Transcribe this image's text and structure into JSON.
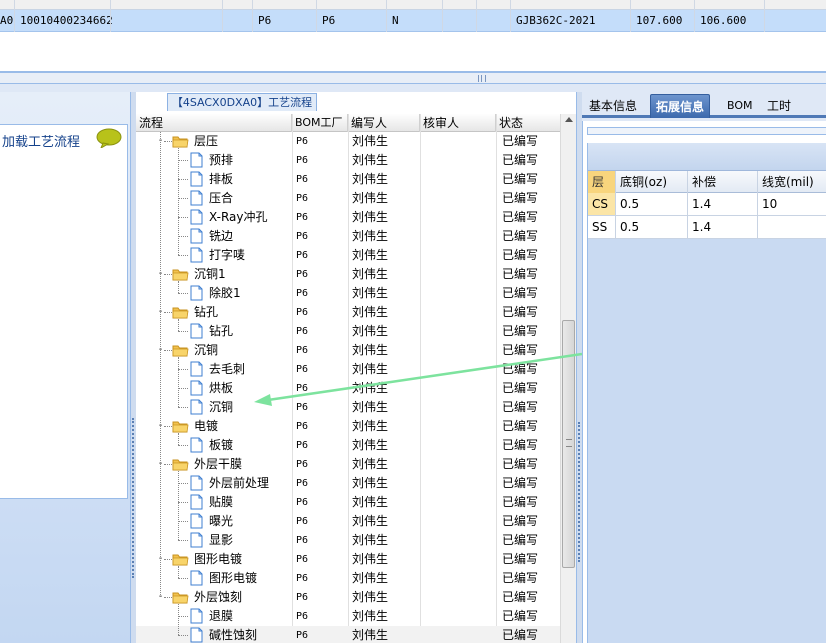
{
  "top_grid": {
    "row": {
      "c0": "A0",
      "c1": "10010400234662",
      "c2": "P6",
      "c3": "P6",
      "c4": "N",
      "c5": "GJB362C-2021",
      "c6": "107.600",
      "c7": "106.600"
    }
  },
  "left_panel": {
    "title": "加载工艺流程",
    "icon": "speech-bubble-icon"
  },
  "tree": {
    "tab_label": "【4SACX0DXA0】工艺流程",
    "headers": {
      "process": "流程",
      "bom": "BOM工厂",
      "writer": "编写人",
      "reviewer": "核审人",
      "status": "状态"
    },
    "nodes": [
      {
        "label": "层压",
        "type": "folder",
        "bom": "P6",
        "writer": "刘伟生",
        "reviewer": "",
        "status": "已编写"
      },
      {
        "label": "预排",
        "type": "file",
        "bom": "P6",
        "writer": "刘伟生",
        "reviewer": "",
        "status": "已编写"
      },
      {
        "label": "排板",
        "type": "file",
        "bom": "P6",
        "writer": "刘伟生",
        "reviewer": "",
        "status": "已编写"
      },
      {
        "label": "压合",
        "type": "file",
        "bom": "P6",
        "writer": "刘伟生",
        "reviewer": "",
        "status": "已编写"
      },
      {
        "label": "X-Ray冲孔",
        "type": "file",
        "bom": "P6",
        "writer": "刘伟生",
        "reviewer": "",
        "status": "已编写"
      },
      {
        "label": "铣边",
        "type": "file",
        "bom": "P6",
        "writer": "刘伟生",
        "reviewer": "",
        "status": "已编写"
      },
      {
        "label": "打字唛",
        "type": "file",
        "bom": "P6",
        "writer": "刘伟生",
        "reviewer": "",
        "status": "已编写"
      },
      {
        "label": "沉铜1",
        "type": "folder",
        "bom": "P6",
        "writer": "刘伟生",
        "reviewer": "",
        "status": "已编写"
      },
      {
        "label": "除胶1",
        "type": "file",
        "bom": "P6",
        "writer": "刘伟生",
        "reviewer": "",
        "status": "已编写"
      },
      {
        "label": "钻孔",
        "type": "folder",
        "bom": "P6",
        "writer": "刘伟生",
        "reviewer": "",
        "status": "已编写"
      },
      {
        "label": "钻孔",
        "type": "file",
        "bom": "P6",
        "writer": "刘伟生",
        "reviewer": "",
        "status": "已编写"
      },
      {
        "label": "沉铜",
        "type": "folder",
        "bom": "P6",
        "writer": "刘伟生",
        "reviewer": "",
        "status": "已编写"
      },
      {
        "label": "去毛刺",
        "type": "file",
        "bom": "P6",
        "writer": "刘伟生",
        "reviewer": "",
        "status": "已编写"
      },
      {
        "label": "烘板",
        "type": "file",
        "bom": "P6",
        "writer": "刘伟生",
        "reviewer": "",
        "status": "已编写"
      },
      {
        "label": "沉铜",
        "type": "file",
        "bom": "P6",
        "writer": "刘伟生",
        "reviewer": "",
        "status": "已编写"
      },
      {
        "label": "电镀",
        "type": "folder",
        "bom": "P6",
        "writer": "刘伟生",
        "reviewer": "",
        "status": "已编写"
      },
      {
        "label": "板镀",
        "type": "file",
        "bom": "P6",
        "writer": "刘伟生",
        "reviewer": "",
        "status": "已编写"
      },
      {
        "label": "外层干膜",
        "type": "folder",
        "bom": "P6",
        "writer": "刘伟生",
        "reviewer": "",
        "status": "已编写"
      },
      {
        "label": "外层前处理",
        "type": "file",
        "bom": "P6",
        "writer": "刘伟生",
        "reviewer": "",
        "status": "已编写"
      },
      {
        "label": "贴膜",
        "type": "file",
        "bom": "P6",
        "writer": "刘伟生",
        "reviewer": "",
        "status": "已编写"
      },
      {
        "label": "曝光",
        "type": "file",
        "bom": "P6",
        "writer": "刘伟生",
        "reviewer": "",
        "status": "已编写"
      },
      {
        "label": "显影",
        "type": "file",
        "bom": "P6",
        "writer": "刘伟生",
        "reviewer": "",
        "status": "已编写"
      },
      {
        "label": "图形电镀",
        "type": "folder",
        "bom": "P6",
        "writer": "刘伟生",
        "reviewer": "",
        "status": "已编写"
      },
      {
        "label": "图形电镀",
        "type": "file",
        "bom": "P6",
        "writer": "刘伟生",
        "reviewer": "",
        "status": "已编写"
      },
      {
        "label": "外层蚀刻",
        "type": "folder",
        "bom": "P6",
        "writer": "刘伟生",
        "reviewer": "",
        "status": "已编写"
      },
      {
        "label": "退膜",
        "type": "file",
        "bom": "P6",
        "writer": "刘伟生",
        "reviewer": "",
        "status": "已编写"
      },
      {
        "label": "碱性蚀刻",
        "type": "file",
        "bom": "P6",
        "writer": "刘伟生",
        "reviewer": "",
        "status": "已编写"
      }
    ]
  },
  "right_panel": {
    "tabs": [
      "基本信息",
      "拓展信息",
      "BOM",
      "工时"
    ],
    "active_tab": "拓展信息",
    "layer_grid": {
      "headers": [
        "层",
        "底铜(oz)",
        "补偿",
        "线宽(mil)"
      ],
      "rows": [
        [
          "CS",
          "0.5",
          "1.4",
          "10"
        ],
        [
          "SS",
          "0.5",
          "1.4",
          ""
        ]
      ]
    }
  },
  "colors": {
    "accent_blue": "#3c69ad",
    "selection_row": "#c4ddfa",
    "folder_yellow": "#f2c14e",
    "arrow_green": "#7de39e"
  }
}
